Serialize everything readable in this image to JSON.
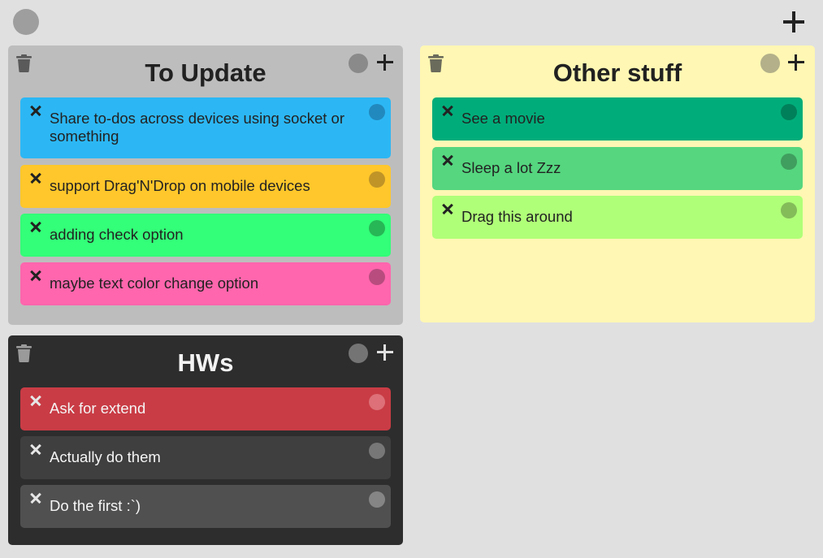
{
  "app": {
    "top_circle_icon": "color-circle-icon",
    "add_board_icon": "plus-icon"
  },
  "boards": [
    {
      "title": "To Update",
      "background": "#bdbdbd",
      "notes": [
        {
          "text": "Share to-dos across devices using socket or something",
          "color": "#2cb7f4",
          "dot": "#2289be"
        },
        {
          "text": "support Drag'N'Drop on mobile devices",
          "color": "#ffc72b",
          "dot": "#c09427"
        },
        {
          "text": "adding check option",
          "color": "#33ff78",
          "dot": "#27b756"
        },
        {
          "text": "maybe text color change option",
          "color": "#ff66ad",
          "dot": "#b84c7f"
        }
      ]
    },
    {
      "title": "Other stuff",
      "background": "#fff7b3",
      "notes": [
        {
          "text": "See a movie",
          "color": "#00ad7a",
          "dot": "#00805a"
        },
        {
          "text": "Sleep a lot Zzz",
          "color": "#55d67f",
          "dot": "#409e5e"
        },
        {
          "text": "Drag this around",
          "color": "#b0ff78",
          "dot": "#84bc5a"
        }
      ]
    },
    {
      "title": "HWs",
      "background": "#2d2d2d",
      "notes": [
        {
          "text": "Ask for extend",
          "color": "#c93c45",
          "dot": "#dd7078"
        },
        {
          "text": "Actually do them",
          "color": "#3f3f3f",
          "dot": "#777777"
        },
        {
          "text": "Do the first :`)",
          "color": "#505050",
          "dot": "#858585"
        }
      ]
    }
  ]
}
